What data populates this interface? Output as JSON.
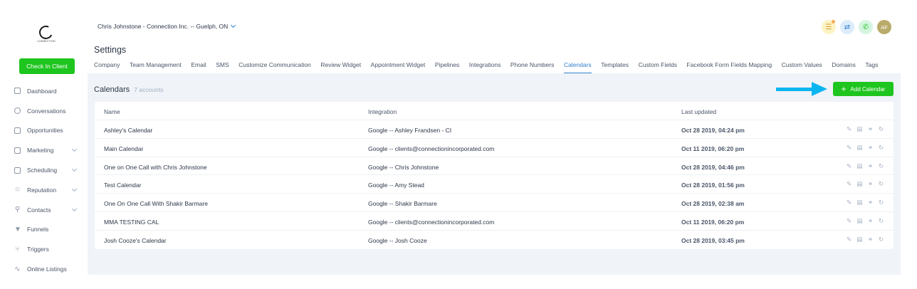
{
  "sidebar": {
    "logo_text": "CONNECTION",
    "checkin_label": "Check In Client",
    "items": [
      {
        "label": "Dashboard",
        "icon": "copy-icon",
        "chevron": false
      },
      {
        "label": "Conversations",
        "icon": "chat-icon",
        "chevron": false
      },
      {
        "label": "Opportunities",
        "icon": "layers-icon",
        "chevron": false
      },
      {
        "label": "Marketing",
        "icon": "mail-icon",
        "chevron": true
      },
      {
        "label": "Scheduling",
        "icon": "calendar-icon",
        "chevron": true
      },
      {
        "label": "Reputation",
        "icon": "star-icon",
        "chevron": true
      },
      {
        "label": "Contacts",
        "icon": "user-icon",
        "chevron": true
      },
      {
        "label": "Funnels",
        "icon": "funnel-icon",
        "chevron": false
      },
      {
        "label": "Triggers",
        "icon": "branch-icon",
        "chevron": false
      },
      {
        "label": "Online Listings",
        "icon": "pulse-icon",
        "chevron": false
      }
    ]
  },
  "header": {
    "account_name": "Chris Johnstone - Connection Inc. -- Guelph, ON",
    "avatar_initials": "AF",
    "page_title": "Settings"
  },
  "tabs": [
    "Company",
    "Team Management",
    "Email",
    "SMS",
    "Customize Communication",
    "Review Widget",
    "Appointment Widget",
    "Pipelines",
    "Integrations",
    "Phone Numbers",
    "Calendars",
    "Templates",
    "Custom Fields",
    "Facebook Form Fields Mapping",
    "Custom Values",
    "Domains",
    "Tags"
  ],
  "active_tab": "Calendars",
  "calendars": {
    "title": "Calendars",
    "count_label": "7 accounts",
    "add_label": "Add Calendar",
    "columns": [
      "Name",
      "Integration",
      "Last updated"
    ],
    "rows": [
      {
        "name": "Ashley's Calendar",
        "integration": "Google -- Ashley Frandsen - CI",
        "updated": "Oct 28 2019, 04:24 pm"
      },
      {
        "name": "Main Calendar",
        "integration": "Google -- clients@connectionincorporated.com",
        "updated": "Oct 11 2019, 06:20 pm"
      },
      {
        "name": "One on One Call with Chris Johnstone",
        "integration": "Google -- Chris Johnstone",
        "updated": "Oct 28 2019, 04:46 pm"
      },
      {
        "name": "Test Calendar",
        "integration": "Google -- Amy Stead",
        "updated": "Oct 28 2019, 01:56 pm"
      },
      {
        "name": "One On One Call With Shakir Barmare",
        "integration": "Google -- Shakir Barmare",
        "updated": "Oct 28 2019, 02:38 am"
      },
      {
        "name": "MMA TESTING CAL",
        "integration": "Google -- clients@connectionincorporated.com",
        "updated": "Oct 11 2019, 06:20 pm"
      },
      {
        "name": "Josh Cooze's Calendar",
        "integration": "Google -- Josh Cooze",
        "updated": "Oct 28 2019, 03:45 pm"
      }
    ]
  },
  "colors": {
    "accent": "#3182ce",
    "brand_green": "#1ec51e",
    "arrow": "#0bb5f0"
  }
}
